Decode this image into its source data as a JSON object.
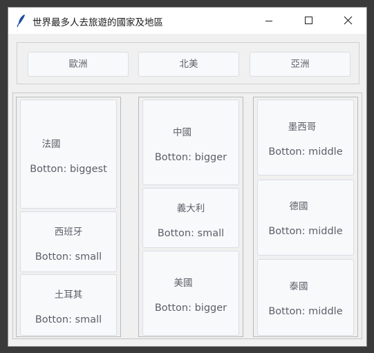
{
  "window": {
    "title": "世界最多人去旅遊的國家及地區"
  },
  "tabs": [
    {
      "label": "歐洲"
    },
    {
      "label": "北美"
    },
    {
      "label": "亞洲"
    }
  ],
  "columns": [
    {
      "items": [
        {
          "name": "法國",
          "size": "Botton: biggest"
        },
        {
          "name": "西班牙",
          "size": "Botton: small"
        },
        {
          "name": "土耳其",
          "size": "Botton: small"
        }
      ]
    },
    {
      "items": [
        {
          "name": "中國",
          "size": "Botton: bigger"
        },
        {
          "name": "義大利",
          "size": "Botton: small"
        },
        {
          "name": "美國",
          "size": "Botton: bigger"
        }
      ]
    },
    {
      "items": [
        {
          "name": "墨西哥",
          "size": "Botton: middle"
        },
        {
          "name": "德國",
          "size": "Botton: middle"
        },
        {
          "name": "泰國",
          "size": "Botton: middle"
        }
      ]
    }
  ],
  "icons": {
    "app": "feather-icon",
    "minimize": "minimize-icon",
    "maximize": "maximize-icon",
    "close": "close-icon"
  }
}
